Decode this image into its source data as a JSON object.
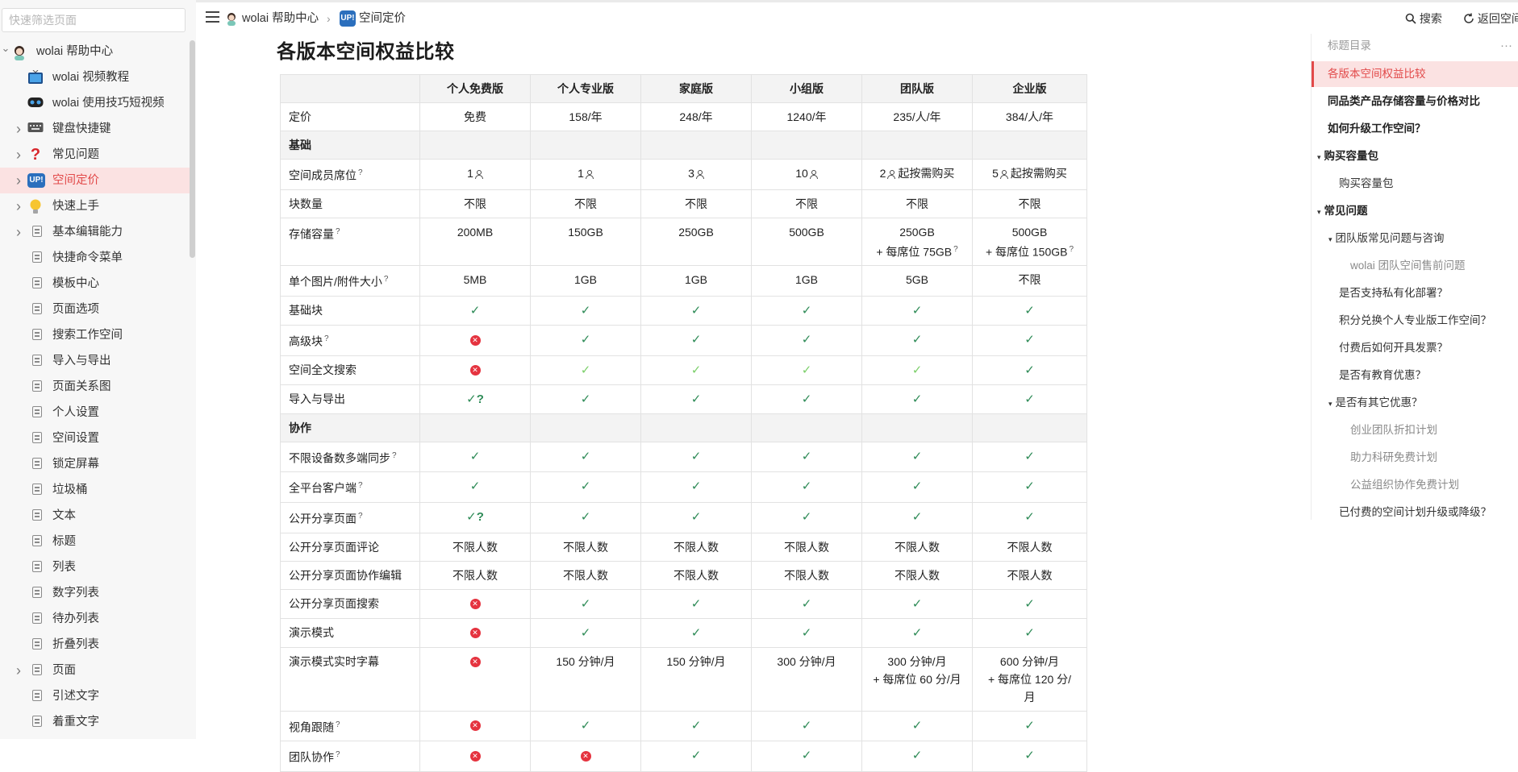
{
  "sidebar": {
    "search_placeholder": "快速筛选页面",
    "items": [
      {
        "label": "wolai 帮助中心",
        "icon": "avatar-icon",
        "expanded": true
      },
      {
        "label": "wolai 视频教程",
        "icon": "tv-icon"
      },
      {
        "label": "wolai 使用技巧短视频",
        "icon": "vr-headset-icon"
      },
      {
        "label": "键盘快捷键",
        "icon": "keyboard-icon"
      },
      {
        "label": "常见问题",
        "icon": "question-mark-icon"
      },
      {
        "label": "空间定价",
        "icon": "up-badge-icon",
        "active": true
      },
      {
        "label": "快速上手",
        "icon": "lightbulb-icon"
      },
      {
        "label": "基本编辑能力",
        "icon": "document-icon"
      },
      {
        "label": "快捷命令菜单",
        "icon": "document-icon"
      },
      {
        "label": "模板中心",
        "icon": "document-icon"
      },
      {
        "label": "页面选项",
        "icon": "document-icon"
      },
      {
        "label": "搜索工作空间",
        "icon": "document-icon"
      },
      {
        "label": "导入与导出",
        "icon": "document-icon"
      },
      {
        "label": "页面关系图",
        "icon": "document-icon"
      },
      {
        "label": "个人设置",
        "icon": "document-icon"
      },
      {
        "label": "空间设置",
        "icon": "document-icon"
      },
      {
        "label": "锁定屏幕",
        "icon": "document-icon"
      },
      {
        "label": "垃圾桶",
        "icon": "document-icon"
      },
      {
        "label": "文本",
        "icon": "document-icon"
      },
      {
        "label": "标题",
        "icon": "document-icon"
      },
      {
        "label": "列表",
        "icon": "document-icon"
      },
      {
        "label": "数字列表",
        "icon": "document-icon"
      },
      {
        "label": "待办列表",
        "icon": "document-icon"
      },
      {
        "label": "折叠列表",
        "icon": "document-icon"
      },
      {
        "label": "页面",
        "icon": "document-icon"
      },
      {
        "label": "引述文字",
        "icon": "document-icon"
      },
      {
        "label": "着重文字",
        "icon": "document-icon"
      }
    ]
  },
  "topbar": {
    "crumb_home": "wolai 帮助中心",
    "crumb_badge": "UP!",
    "crumb_current": "空间定价",
    "search_label": "搜索",
    "back_label": "返回空间"
  },
  "main": {
    "title": "各版本空间权益比较",
    "columns": [
      "",
      "个人免费版",
      "个人专业版",
      "家庭版",
      "小组版",
      "团队版",
      "企业版"
    ],
    "rows": [
      {
        "label": "定价",
        "cells": [
          "免费",
          "158/年",
          "248/年",
          "1240/年",
          "235/人/年",
          "384/人/年"
        ]
      },
      {
        "section": "基础"
      },
      {
        "label": "空间成员席位",
        "q": "?",
        "cells": [
          "1",
          "1",
          "3",
          "10",
          "2",
          "5"
        ],
        "person": true,
        "extras": [
          "",
          "",
          "",
          "",
          "起按需购买",
          "起按需购买"
        ]
      },
      {
        "label": "块数量",
        "cells": [
          "不限",
          "不限",
          "不限",
          "不限",
          "不限",
          "不限"
        ]
      },
      {
        "label": "存储容量",
        "q": "?",
        "cells": [
          "200MB",
          "150GB",
          "250GB",
          "500GB",
          "250GB",
          "500GB"
        ],
        "second": [
          "",
          "",
          "",
          "",
          "+ 每席位 75GB",
          "+ 每席位 150GB"
        ]
      },
      {
        "label": "单个图片/附件大小",
        "q": "?",
        "cells": [
          "5MB",
          "1GB",
          "1GB",
          "1GB",
          "5GB",
          "不限"
        ]
      },
      {
        "label": "基础块",
        "cells": [
          "✓",
          "✓",
          "✓",
          "✓",
          "✓",
          "✓"
        ]
      },
      {
        "label": "高级块",
        "q": "?",
        "cells": [
          "✕",
          "✓",
          "✓",
          "✓",
          "✓",
          "✓"
        ]
      },
      {
        "label": "空间全文搜索",
        "cells": [
          "✕",
          "✓",
          "✓",
          "✓",
          "✓",
          "✓"
        ],
        "light": [
          false,
          true,
          true,
          true,
          true,
          false
        ]
      },
      {
        "label": "导入与导出",
        "cells": [
          "✓?",
          "✓",
          "✓",
          "✓",
          "✓",
          "✓"
        ]
      },
      {
        "section": "协作"
      },
      {
        "label": "不限设备数多端同步",
        "q": "?",
        "cells": [
          "✓",
          "✓",
          "✓",
          "✓",
          "✓",
          "✓"
        ]
      },
      {
        "label": "全平台客户端",
        "q": "?",
        "cells": [
          "✓",
          "✓",
          "✓",
          "✓",
          "✓",
          "✓"
        ]
      },
      {
        "label": "公开分享页面",
        "q": "?",
        "cells": [
          "✓?",
          "✓",
          "✓",
          "✓",
          "✓",
          "✓"
        ]
      },
      {
        "label": "公开分享页面评论",
        "cells": [
          "不限人数",
          "不限人数",
          "不限人数",
          "不限人数",
          "不限人数",
          "不限人数"
        ]
      },
      {
        "label": "公开分享页面协作编辑",
        "cells": [
          "不限人数",
          "不限人数",
          "不限人数",
          "不限人数",
          "不限人数",
          "不限人数"
        ]
      },
      {
        "label": "公开分享页面搜索",
        "cells": [
          "✕",
          "✓",
          "✓",
          "✓",
          "✓",
          "✓"
        ]
      },
      {
        "label": "演示模式",
        "cells": [
          "✕",
          "✓",
          "✓",
          "✓",
          "✓",
          "✓"
        ]
      },
      {
        "label": "演示模式实时字幕",
        "cells": [
          "✕",
          "150 分钟/月",
          "150 分钟/月",
          "300 分钟/月",
          "300 分钟/月",
          "600 分钟/月"
        ],
        "second": [
          "",
          "",
          "",
          "",
          "+ 每席位 60 分/月",
          "+ 每席位 120 分/"
        ],
        "third": [
          "",
          "",
          "",
          "",
          "",
          "月"
        ]
      },
      {
        "label": "视角跟随",
        "q": "?",
        "cells": [
          "✕",
          "✓",
          "✓",
          "✓",
          "✓",
          "✓"
        ]
      },
      {
        "label": "团队协作",
        "q": "?",
        "cells": [
          "✕",
          "✕",
          "✓",
          "✓",
          "✓",
          "✓"
        ]
      }
    ]
  },
  "toc": {
    "title": "标题目录",
    "more": "···",
    "items": [
      {
        "label": "各版本空间权益比较",
        "level": 1,
        "active": true
      },
      {
        "label": "同品类产品存储容量与价格对比",
        "level": 1
      },
      {
        "label": "如何升级工作空间？",
        "level": 1
      },
      {
        "label": "购买容量包",
        "level": 1,
        "toggle": "▾"
      },
      {
        "label": "购买容量包",
        "level": 2
      },
      {
        "label": "常见问题",
        "level": 1,
        "toggle": "▾"
      },
      {
        "label": "团队版常见问题与咨询",
        "level": 2,
        "toggle": "▾"
      },
      {
        "label": "wolai 团队空间售前问题",
        "level": 3
      },
      {
        "label": "是否支持私有化部署？",
        "level": 2
      },
      {
        "label": "积分兑换个人专业版工作空间？",
        "level": 2
      },
      {
        "label": "付费后如何开具发票？",
        "level": 2
      },
      {
        "label": "是否有教育优惠？",
        "level": 2
      },
      {
        "label": "是否有其它优惠？",
        "level": 2,
        "toggle": "▾"
      },
      {
        "label": "创业团队折扣计划",
        "level": 3
      },
      {
        "label": "助力科研免费计划",
        "level": 3
      },
      {
        "label": "公益组织协作免费计划",
        "level": 3
      },
      {
        "label": "已付费的空间计划升级或降级？",
        "level": 2
      }
    ]
  },
  "colors": {
    "accent": "#e24a4a",
    "active_bg": "#fbe2e2",
    "check": "#2e8b57",
    "cross": "#e5333f"
  }
}
